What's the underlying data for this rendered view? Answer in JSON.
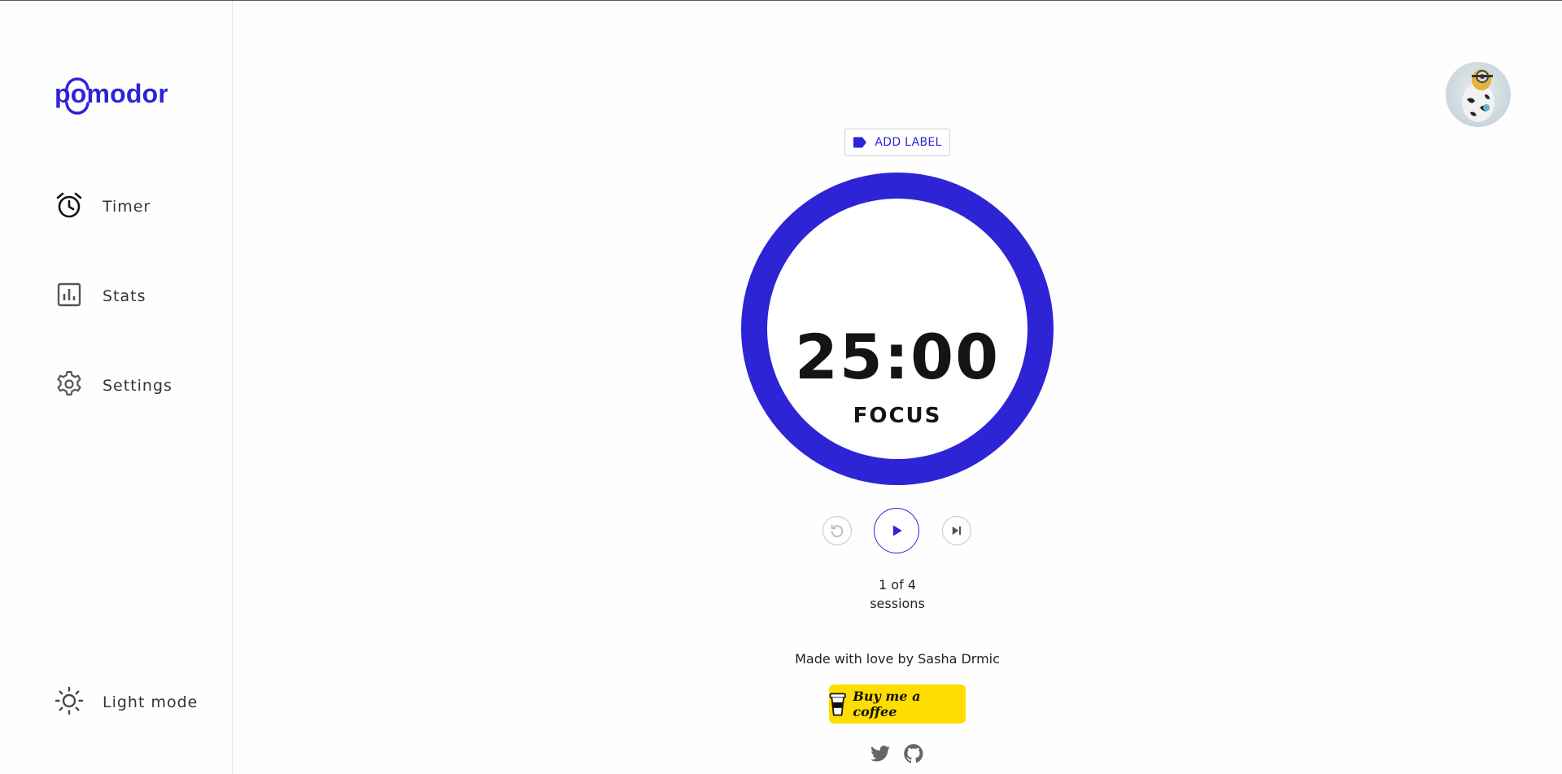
{
  "brand": {
    "logo_text": "pomodor",
    "accent_color": "#2d24d6"
  },
  "sidebar": {
    "items": [
      {
        "label": "Timer",
        "icon": "alarm-clock-icon"
      },
      {
        "label": "Stats",
        "icon": "bar-chart-icon"
      },
      {
        "label": "Settings",
        "icon": "gear-icon"
      }
    ],
    "theme_toggle": {
      "label": "Light mode",
      "icon": "sun-icon"
    }
  },
  "header": {
    "avatar": "user-avatar"
  },
  "timer": {
    "add_label_text": "ADD LABEL",
    "time": "25:00",
    "mode": "FOCUS",
    "session_count": "1 of 4",
    "session_word": "sessions",
    "controls": [
      "reset-icon",
      "play-icon",
      "skip-next-icon"
    ]
  },
  "footer": {
    "credit": "Made with love by Sasha Drmic",
    "coffee_label": "Buy me a coffee",
    "social": [
      "twitter-icon",
      "github-icon"
    ]
  }
}
